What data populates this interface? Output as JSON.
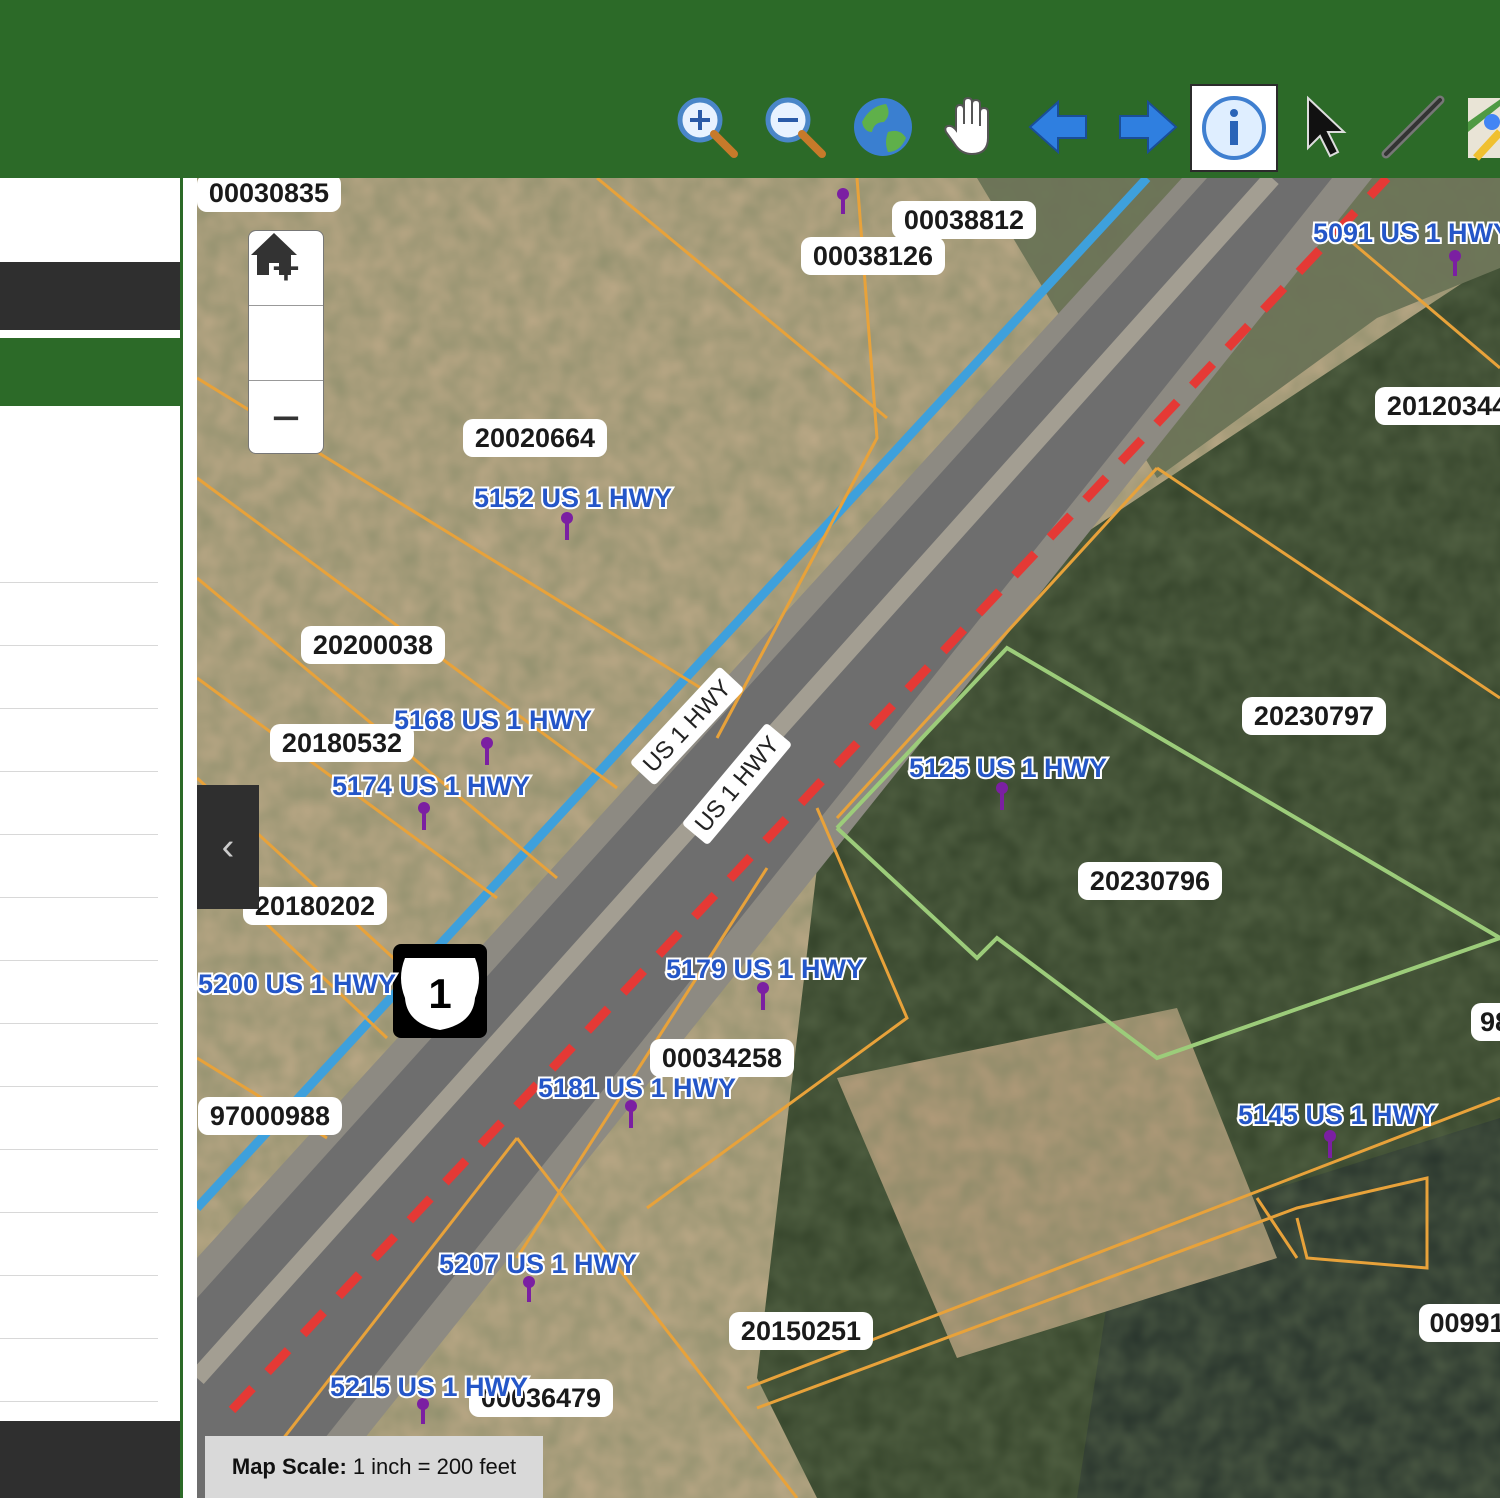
{
  "toolbar": {
    "tools": [
      {
        "name": "zoom-in-tool",
        "icon": "magnifier-plus-icon"
      },
      {
        "name": "zoom-out-tool",
        "icon": "magnifier-minus-icon"
      },
      {
        "name": "full-extent-tool",
        "icon": "globe-icon"
      },
      {
        "name": "pan-tool",
        "icon": "hand-icon"
      },
      {
        "name": "previous-extent-tool",
        "icon": "arrow-left-icon"
      },
      {
        "name": "next-extent-tool",
        "icon": "arrow-right-icon"
      },
      {
        "name": "identify-tool",
        "icon": "info-icon",
        "active": true
      },
      {
        "name": "select-tool",
        "icon": "pointer-icon"
      },
      {
        "name": "measure-tool",
        "icon": "ruler-line-icon"
      },
      {
        "name": "google-maps-tool",
        "icon": "google-maps-icon"
      }
    ]
  },
  "map": {
    "zoom_controls": {
      "zoom_in": "+",
      "home": "home-icon",
      "zoom_out": "−"
    },
    "collapse_panel": "‹",
    "scale": {
      "label": "Map Scale:",
      "value": "1 inch = 200 feet"
    },
    "parcel_ids": [
      "00030835",
      "00038812",
      "00038126",
      "20020664",
      "20200038",
      "20180532",
      "20180202",
      "97000988",
      "20120344",
      "20230797",
      "20230796",
      "00034258",
      "20150251",
      "00036479",
      "00991",
      "98"
    ],
    "addresses": [
      "5091 US 1 HWY",
      "5152 US 1 HWY",
      "5168 US 1 HWY",
      "5174 US 1 HWY",
      "5125 US 1 HWY",
      "5200 US 1 HWY",
      "5179 US 1 HWY",
      "5181 US 1 HWY",
      "5145 US 1 HWY",
      "5207 US 1 HWY",
      "5215 US 1 HWY"
    ],
    "road_labels": [
      "US 1 HWY",
      "US 1 HWY"
    ],
    "route_shield": "1",
    "colors": {
      "parcel_line": "#e8a23a",
      "address_text": "#2456c8",
      "road_highlight": "#3ea0dc",
      "dashed_line": "#e53935",
      "green_parcel": "#9ccc7a",
      "pin": "#7b1fa2"
    }
  }
}
